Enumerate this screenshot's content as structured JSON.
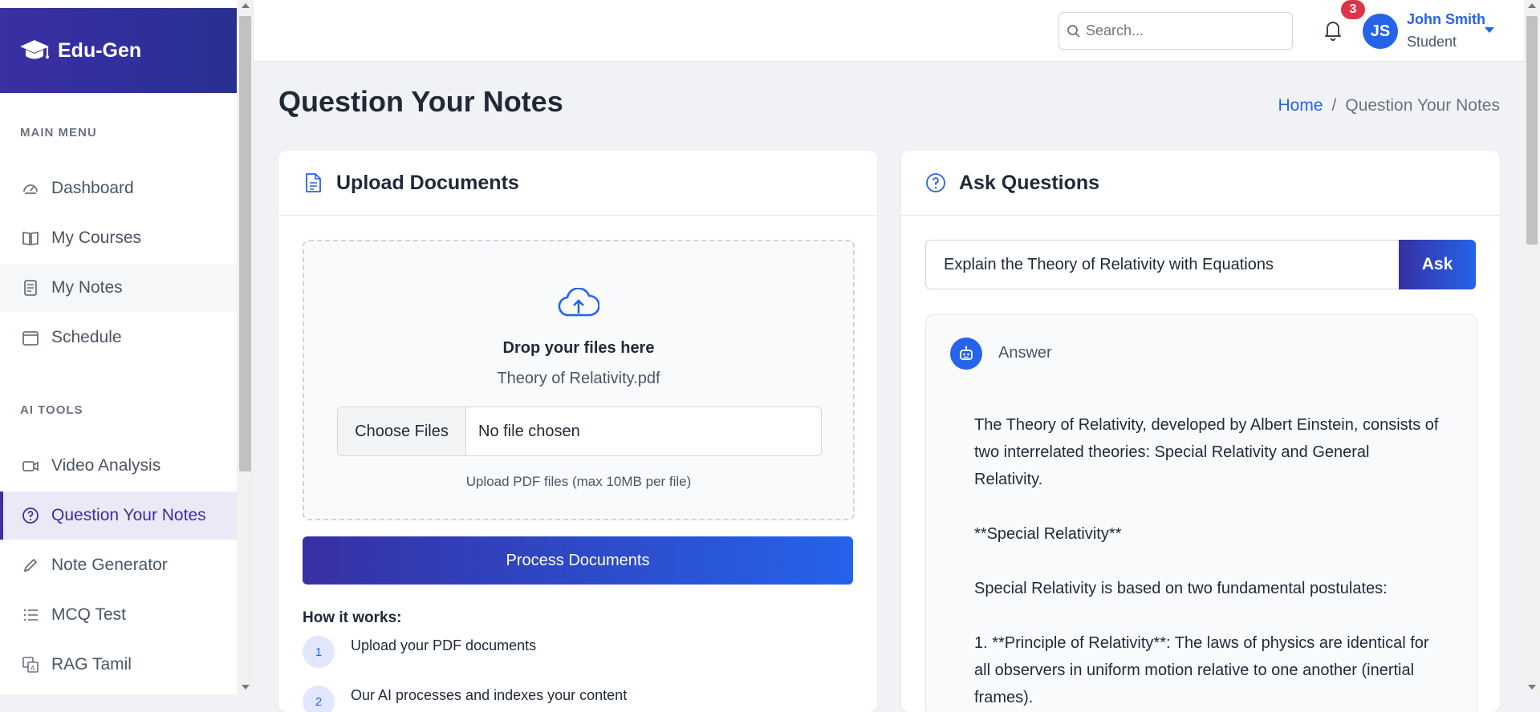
{
  "brand": {
    "name": "Edu-Gen"
  },
  "sidebar": {
    "main_menu_label": "MAIN MENU",
    "main_items": [
      {
        "label": "Dashboard",
        "icon": "speedometer-icon"
      },
      {
        "label": "My Courses",
        "icon": "book-icon"
      },
      {
        "label": "My Notes",
        "icon": "notes-icon"
      },
      {
        "label": "Schedule",
        "icon": "calendar-icon"
      }
    ],
    "ai_tools_label": "AI TOOLS",
    "ai_items": [
      {
        "label": "Video Analysis",
        "icon": "video-icon"
      },
      {
        "label": "Question Your Notes",
        "icon": "question-circle-icon",
        "active": true
      },
      {
        "label": "Note Generator",
        "icon": "pencil-icon"
      },
      {
        "label": "MCQ Test",
        "icon": "list-icon"
      },
      {
        "label": "RAG Tamil",
        "icon": "translate-icon"
      }
    ]
  },
  "topbar": {
    "search_placeholder": "Search...",
    "notification_count": "3",
    "user": {
      "initials": "JS",
      "name": "John Smith",
      "role": "Student"
    }
  },
  "page": {
    "title": "Question Your Notes",
    "breadcrumb": {
      "home": "Home",
      "separator": "/",
      "current": "Question Your Notes"
    }
  },
  "upload": {
    "title": "Upload Documents",
    "drop_text": "Drop your files here",
    "file_name": "Theory of Relativity.pdf",
    "choose_label": "Choose Files",
    "chosen_label": "No file chosen",
    "hint": "Upload PDF files (max 10MB per file)",
    "process_label": "Process Documents",
    "how_title": "How it works:",
    "steps": [
      {
        "num": "1",
        "text": "Upload your PDF documents"
      },
      {
        "num": "2",
        "text": "Our AI processes and indexes your content"
      }
    ]
  },
  "ask": {
    "title": "Ask Questions",
    "question_value": "Explain the Theory of Relativity with Equations",
    "ask_label": "Ask",
    "answer_label": "Answer",
    "answer_paragraphs": [
      "The Theory of Relativity, developed by Albert Einstein, consists of two interrelated theories: Special Relativity and General Relativity.",
      "**Special Relativity**",
      "Special Relativity is based on two fundamental postulates:",
      "1. **Principle of Relativity**: The laws of physics are identical for all observers in uniform motion relative to one another (inertial frames)."
    ]
  },
  "colors": {
    "brand_gradient_start": "#3a2fa3",
    "accent_blue": "#2563eb",
    "badge_red": "#dc3545",
    "active_bg": "#ece9f7"
  }
}
